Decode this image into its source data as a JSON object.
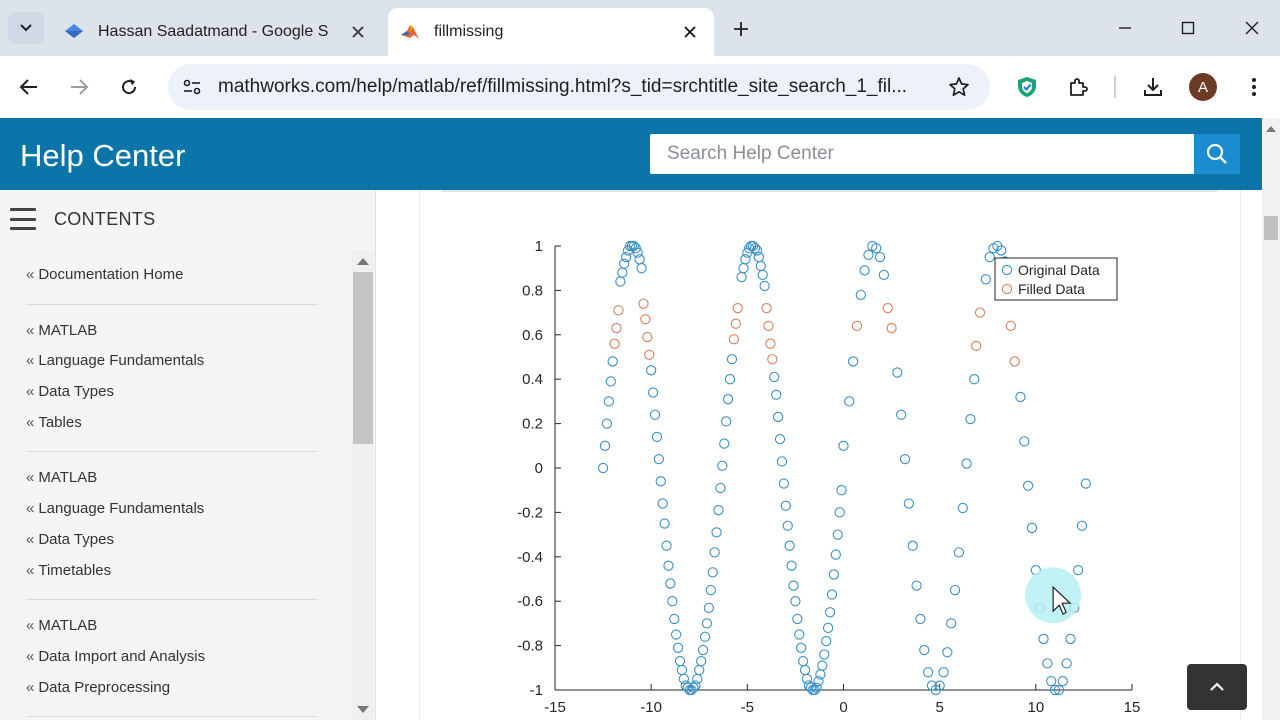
{
  "browser": {
    "tabs": [
      {
        "title": "Hassan Saadatmand - Google S",
        "favicon": "google-scholar-icon",
        "active": false
      },
      {
        "title": "fillmissing",
        "favicon": "matlab-icon",
        "active": true
      }
    ],
    "url": "mathworks.com/help/matlab/ref/fillmissing.html?s_tid=srchtitle_site_search_1_fil...",
    "avatar_letter": "A",
    "accent": "#0b74a8"
  },
  "header": {
    "title": "Help Center",
    "search_placeholder": "Search Help Center"
  },
  "sidebar": {
    "contents_label": "CONTENTS",
    "groups": [
      {
        "items": [
          "Documentation Home"
        ]
      },
      {
        "items": [
          "MATLAB",
          "Language Fundamentals",
          "Data Types",
          "Tables"
        ]
      },
      {
        "items": [
          "MATLAB",
          "Language Fundamentals",
          "Data Types",
          "Timetables"
        ]
      },
      {
        "items": [
          "MATLAB",
          "Data Import and Analysis",
          "Data Preprocessing"
        ]
      }
    ]
  },
  "chart_data": {
    "type": "scatter",
    "title": "",
    "xlabel": "",
    "ylabel": "",
    "xlim": [
      -15,
      15
    ],
    "ylim": [
      -1,
      1
    ],
    "xticks": [
      "-15",
      "-10",
      "-5",
      "0",
      "5",
      "10",
      "15"
    ],
    "yticks": [
      "-1",
      "-0.8",
      "-0.6",
      "-0.4",
      "-0.2",
      "0",
      "0.2",
      "0.4",
      "0.6",
      "0.8",
      "1"
    ],
    "legend_position": "top-right",
    "series": [
      {
        "name": "Original Data",
        "color": "#3a8fc7",
        "marker": "circle-open",
        "points": [
          [
            -12.5,
            0.0
          ],
          [
            -12.4,
            0.1
          ],
          [
            -12.3,
            0.2
          ],
          [
            -12.2,
            0.3
          ],
          [
            -12.1,
            0.39
          ],
          [
            -12.0,
            0.48
          ],
          [
            -11.6,
            0.84
          ],
          [
            -11.5,
            0.88
          ],
          [
            -11.4,
            0.92
          ],
          [
            -11.3,
            0.95
          ],
          [
            -11.2,
            0.98
          ],
          [
            -11.1,
            1.0
          ],
          [
            -11.0,
            1.0
          ],
          [
            -10.9,
            1.0
          ],
          [
            -10.8,
            0.99
          ],
          [
            -10.7,
            0.97
          ],
          [
            -10.6,
            0.94
          ],
          [
            -10.5,
            0.9
          ],
          [
            -10.0,
            0.44
          ],
          [
            -9.9,
            0.34
          ],
          [
            -9.8,
            0.24
          ],
          [
            -9.7,
            0.14
          ],
          [
            -9.6,
            0.04
          ],
          [
            -9.5,
            -0.06
          ],
          [
            -9.4,
            -0.16
          ],
          [
            -9.3,
            -0.25
          ],
          [
            -9.2,
            -0.35
          ],
          [
            -9.1,
            -0.44
          ],
          [
            -9.0,
            -0.52
          ],
          [
            -8.9,
            -0.6
          ],
          [
            -8.8,
            -0.68
          ],
          [
            -8.7,
            -0.75
          ],
          [
            -8.6,
            -0.81
          ],
          [
            -8.5,
            -0.87
          ],
          [
            -8.4,
            -0.91
          ],
          [
            -8.3,
            -0.95
          ],
          [
            -8.2,
            -0.98
          ],
          [
            -8.1,
            -0.99
          ],
          [
            -8.0,
            -1.0
          ],
          [
            -7.9,
            -1.0
          ],
          [
            -7.8,
            -0.99
          ],
          [
            -7.7,
            -0.98
          ],
          [
            -7.6,
            -0.95
          ],
          [
            -7.5,
            -0.91
          ],
          [
            -7.4,
            -0.87
          ],
          [
            -7.3,
            -0.82
          ],
          [
            -7.2,
            -0.76
          ],
          [
            -7.1,
            -0.7
          ],
          [
            -7.0,
            -0.63
          ],
          [
            -6.9,
            -0.55
          ],
          [
            -6.8,
            -0.47
          ],
          [
            -6.7,
            -0.38
          ],
          [
            -6.6,
            -0.29
          ],
          [
            -6.5,
            -0.19
          ],
          [
            -6.4,
            -0.09
          ],
          [
            -6.3,
            0.01
          ],
          [
            -6.2,
            0.11
          ],
          [
            -6.1,
            0.21
          ],
          [
            -6.0,
            0.31
          ],
          [
            -5.9,
            0.4
          ],
          [
            -5.8,
            0.49
          ],
          [
            -5.3,
            0.86
          ],
          [
            -5.2,
            0.9
          ],
          [
            -5.1,
            0.94
          ],
          [
            -5.0,
            0.97
          ],
          [
            -4.9,
            0.99
          ],
          [
            -4.8,
            1.0
          ],
          [
            -4.7,
            1.0
          ],
          [
            -4.6,
            0.99
          ],
          [
            -4.5,
            0.98
          ],
          [
            -4.4,
            0.95
          ],
          [
            -4.3,
            0.91
          ],
          [
            -4.2,
            0.87
          ],
          [
            -4.1,
            0.82
          ],
          [
            -3.6,
            0.41
          ],
          [
            -3.5,
            0.33
          ],
          [
            -3.4,
            0.23
          ],
          [
            -3.3,
            0.13
          ],
          [
            -3.2,
            0.03
          ],
          [
            -3.1,
            -0.07
          ],
          [
            -3.0,
            -0.17
          ],
          [
            -2.9,
            -0.26
          ],
          [
            -2.8,
            -0.35
          ],
          [
            -2.7,
            -0.44
          ],
          [
            -2.6,
            -0.53
          ],
          [
            -2.5,
            -0.6
          ],
          [
            -2.4,
            -0.68
          ],
          [
            -2.3,
            -0.75
          ],
          [
            -2.2,
            -0.81
          ],
          [
            -2.1,
            -0.87
          ],
          [
            -2.0,
            -0.91
          ],
          [
            -1.9,
            -0.95
          ],
          [
            -1.8,
            -0.98
          ],
          [
            -1.7,
            -0.99
          ],
          [
            -1.6,
            -1.0
          ],
          [
            -1.5,
            -1.0
          ],
          [
            -1.4,
            -0.99
          ],
          [
            -1.3,
            -0.96
          ],
          [
            -1.2,
            -0.93
          ],
          [
            -1.1,
            -0.89
          ],
          [
            -1.0,
            -0.84
          ],
          [
            -0.9,
            -0.78
          ],
          [
            -0.8,
            -0.72
          ],
          [
            -0.7,
            -0.65
          ],
          [
            -0.6,
            -0.57
          ],
          [
            -0.5,
            -0.48
          ],
          [
            -0.4,
            -0.39
          ],
          [
            -0.3,
            -0.3
          ],
          [
            -0.2,
            -0.2
          ],
          [
            -0.1,
            -0.1
          ],
          [
            0.0,
            0.1
          ],
          [
            0.3,
            0.3
          ],
          [
            0.5,
            0.48
          ],
          [
            0.9,
            0.78
          ],
          [
            1.1,
            0.89
          ],
          [
            1.3,
            0.96
          ],
          [
            1.5,
            1.0
          ],
          [
            1.7,
            0.99
          ],
          [
            1.9,
            0.95
          ],
          [
            2.1,
            0.87
          ],
          [
            2.8,
            0.43
          ],
          [
            3.0,
            0.24
          ],
          [
            3.2,
            0.04
          ],
          [
            3.4,
            -0.16
          ],
          [
            3.6,
            -0.35
          ],
          [
            3.8,
            -0.53
          ],
          [
            4.0,
            -0.68
          ],
          [
            4.2,
            -0.82
          ],
          [
            4.4,
            -0.92
          ],
          [
            4.6,
            -0.98
          ],
          [
            4.8,
            -1.0
          ],
          [
            5.0,
            -0.98
          ],
          [
            5.2,
            -0.92
          ],
          [
            5.4,
            -0.83
          ],
          [
            5.6,
            -0.7
          ],
          [
            5.8,
            -0.55
          ],
          [
            6.0,
            -0.38
          ],
          [
            6.2,
            -0.18
          ],
          [
            6.4,
            0.02
          ],
          [
            6.6,
            0.22
          ],
          [
            6.8,
            0.4
          ],
          [
            7.4,
            0.85
          ],
          [
            7.6,
            0.95
          ],
          [
            7.8,
            0.99
          ],
          [
            8.0,
            1.0
          ],
          [
            8.2,
            0.98
          ],
          [
            8.4,
            0.93
          ],
          [
            9.2,
            0.32
          ],
          [
            9.4,
            0.12
          ],
          [
            9.6,
            -0.08
          ],
          [
            9.8,
            -0.27
          ],
          [
            10.0,
            -0.46
          ],
          [
            10.2,
            -0.63
          ],
          [
            10.4,
            -0.77
          ],
          [
            10.6,
            -0.88
          ],
          [
            10.8,
            -0.96
          ],
          [
            11.0,
            -1.0
          ],
          [
            11.2,
            -1.0
          ],
          [
            11.4,
            -0.96
          ],
          [
            11.6,
            -0.88
          ],
          [
            11.8,
            -0.77
          ],
          [
            12.0,
            -0.63
          ],
          [
            12.2,
            -0.46
          ],
          [
            12.4,
            -0.26
          ],
          [
            12.6,
            -0.07
          ]
        ]
      },
      {
        "name": "Filled Data",
        "color": "#d67f5a",
        "marker": "circle-open",
        "points": [
          [
            -11.9,
            0.56
          ],
          [
            -11.8,
            0.63
          ],
          [
            -11.7,
            0.71
          ],
          [
            -10.4,
            0.74
          ],
          [
            -10.3,
            0.67
          ],
          [
            -10.2,
            0.59
          ],
          [
            -10.1,
            0.51
          ],
          [
            -5.7,
            0.58
          ],
          [
            -5.6,
            0.65
          ],
          [
            -5.5,
            0.72
          ],
          [
            -4.0,
            0.72
          ],
          [
            -3.9,
            0.64
          ],
          [
            -3.8,
            0.56
          ],
          [
            -3.7,
            0.49
          ],
          [
            0.7,
            0.64
          ],
          [
            2.3,
            0.72
          ],
          [
            2.5,
            0.63
          ],
          [
            6.9,
            0.55
          ],
          [
            7.1,
            0.7
          ],
          [
            8.7,
            0.64
          ],
          [
            8.9,
            0.48
          ]
        ]
      }
    ]
  },
  "cursor": {
    "x": 10.9,
    "y": -0.6
  }
}
